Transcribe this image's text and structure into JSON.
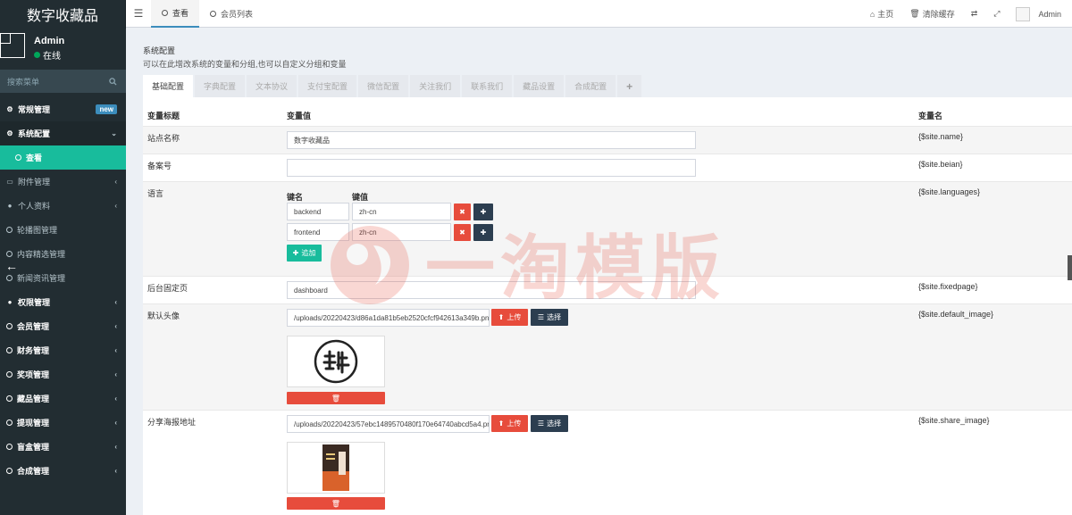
{
  "app": {
    "title": "数字收藏品"
  },
  "user": {
    "name": "Admin",
    "status": "在线"
  },
  "sidebar": {
    "search_placeholder": "搜索菜单",
    "items": [
      {
        "label": "常规管理",
        "badge": "new"
      },
      {
        "label": "系统配置"
      },
      {
        "label": "查看"
      },
      {
        "label": "附件管理"
      },
      {
        "label": "个人资料"
      },
      {
        "label": "轮播图管理"
      },
      {
        "label": "内容精选管理"
      },
      {
        "label": "新闻资讯管理"
      },
      {
        "label": "权限管理"
      },
      {
        "label": "会员管理"
      },
      {
        "label": "财务管理"
      },
      {
        "label": "奖项管理"
      },
      {
        "label": "藏品管理"
      },
      {
        "label": "提现管理"
      },
      {
        "label": "盲盒管理"
      },
      {
        "label": "合成管理"
      }
    ]
  },
  "topbar": {
    "tabs": [
      {
        "label": "查看"
      },
      {
        "label": "会员列表"
      }
    ],
    "home": "主页",
    "clear_cache": "清除缓存",
    "admin": "Admin"
  },
  "panel": {
    "title": "系统配置",
    "subtitle": "可以在此增改系统的变量和分组,也可以自定义分组和变量",
    "tabs": [
      "基础配置",
      "字典配置",
      "文本协议",
      "支付宝配置",
      "微信配置",
      "关注我们",
      "联系我们",
      "藏品设置",
      "合成配置"
    ],
    "plus": "+"
  },
  "table": {
    "headers": {
      "title": "变量标题",
      "value": "变量值",
      "name": "变量名"
    },
    "rows": {
      "site_name": {
        "label": "站点名称",
        "value": "数字收藏品",
        "var": "{$site.name}"
      },
      "beian": {
        "label": "备案号",
        "value": "",
        "var": "{$site.beian}"
      },
      "languages": {
        "label": "语言",
        "key_header": "键名",
        "val_header": "键值",
        "pairs": [
          {
            "key": "backend",
            "val": "zh-cn"
          },
          {
            "key": "frontend",
            "val": "zh-cn"
          }
        ],
        "add_label": "追加",
        "var": "{$site.languages}"
      },
      "fixedpage": {
        "label": "后台固定页",
        "value": "dashboard",
        "var": "{$site.fixedpage}"
      },
      "default_image": {
        "label": "默认头像",
        "value": "/uploads/20220423/d86a1da81b5eb2520cfcf942613a349b.pn",
        "var": "{$site.default_image}"
      },
      "share_image": {
        "label": "分享海报地址",
        "value": "/uploads/20220423/57ebc1489570480f170e64740abcd5a4.pn",
        "var": "{$site.share_image}"
      }
    },
    "upload_label": "上传",
    "choose_label": "选择"
  },
  "watermark": {
    "text": "一淘模版"
  }
}
